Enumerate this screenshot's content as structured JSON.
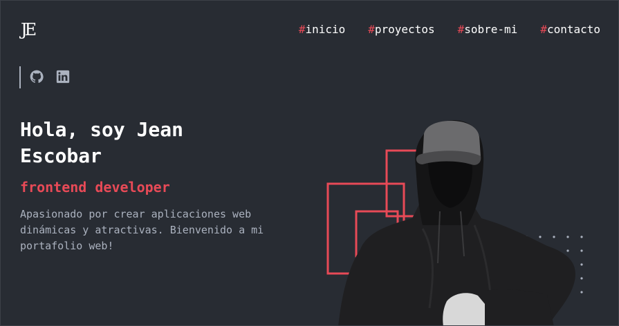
{
  "header": {
    "logo": "JE",
    "nav": [
      {
        "hash": "#",
        "label": "inicio"
      },
      {
        "hash": "#",
        "label": "proyectos"
      },
      {
        "hash": "#",
        "label": "sobre-mi"
      },
      {
        "hash": "#",
        "label": "contacto"
      }
    ]
  },
  "social": {
    "icons": [
      "github-icon",
      "linkedin-icon"
    ]
  },
  "hero": {
    "title": "Hola, soy Jean Escobar",
    "role": "frontend developer",
    "description": "Apasionado por crear aplicaciones web dinámicas y atractivas. Bienvenido a mi portafolio web!"
  },
  "colors": {
    "background": "#282c33",
    "accent": "#e84a57",
    "text": "#ffffff",
    "muted": "#abb2bf"
  }
}
